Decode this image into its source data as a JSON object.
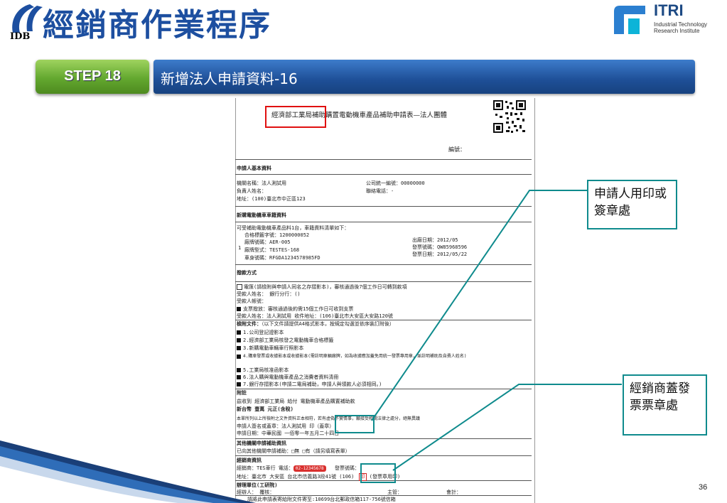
{
  "header": {
    "logo_text": "IDB",
    "title": "經銷商作業程序",
    "partner_logo": {
      "name": "ITRI",
      "subtitle_lines": [
        "Industrial Technology",
        "Research Institute"
      ]
    }
  },
  "step": {
    "badge": "STEP 18",
    "title": "新增法人申請資料-16"
  },
  "document": {
    "form_title": "經濟部工業局補助購置電動機車產品補助申請表—法人團體",
    "serial_label": "編號：",
    "applicant": {
      "heading": "申請人基本資料",
      "org_name": "機關名稱：法人測試用",
      "owner": "負責人姓名：",
      "address": "地址：(100)臺北市中正區123",
      "tax_id": "公司統一編號：00000000",
      "phone": "聯絡電話：-"
    },
    "vehicle": {
      "heading": "新購電動機車車籍資料",
      "intro": "可受補助電動機車產品料1台，車籍資料清單如下：",
      "index": "1",
      "lines": [
        "合格標籤字號：1200000052",
        "廠牌號碼：AER-005",
        "廠牌型式：TESTES-168",
        "車身號碼：RFGDA1234578985FD"
      ],
      "right_lines": [
        "出廠日期：2012/05",
        "發票號碼：QW85968596",
        "發票日期：2012/05/22"
      ]
    },
    "payment": {
      "heading": "撥款方式",
      "option1": "電匯(請檢附與申請人同名之存摺影本)，審核通過後7個工作日可轉到款項",
      "payee": "受款人姓名：  銀行分行：()",
      "account": "受款人帳號：",
      "option2": "支票撥放：審核通過後約需15個工作日可收到支票",
      "mail": "受款人姓名：法人測試用  收件地址：(106)臺北市大安區大安路120號"
    },
    "attachments": {
      "heading": "檢附文件：",
      "note": "（以下文件請提供A4格式影本，按規定勾選並依序裝訂附後）",
      "items": [
        "1.公司登記證影本",
        "2.經濟部工業局核發之電動機車合格標籤",
        "3.新購電動車輛車行照影本",
        "4.購車發票或收據影本或收據影本(需註明車輛廠牌，如為收據應加蓋免用統一發票專用章，並註明補助及自費人姓名)",
        "5.工業局核准函影本",
        "6.法人購與電動機車產品之消費者資料清冊",
        "7.銀行存摺影本(申請二電局補助，申請人與領款人必須相同。)"
      ]
    },
    "consent": {
      "heading": "附註",
      "line1": "茲收到 經濟部工業局  給付  電動機車產品購置補助款",
      "line2": "新台幣 壹萬 元正(含稅)",
      "line3": "本單所列以上所檢附之文件資料正本相符，若有虛偽不實情事，願接受相關法律之處分，絕無異議",
      "line4": "申請人簽名或蓋章：法人測試用     印（蓋章）",
      "line5": "申請日期：中華民國 一佰零一年五月二十四日"
    },
    "other_subsidy": {
      "heading": "其他機關申請補助資訊",
      "line": "已向其他機關申請補助：□無 □有（請另填寫表單）"
    },
    "dealer": {
      "heading": "經銷商資訊",
      "line1_prefix": "經銷商：TES車行 電話：",
      "phone": "02-12345678",
      "line1_suffix": "發票號碼：",
      "line2": "地址：臺北市 大安區 台北市信義路3段41號 (106)",
      "stamp_char": "印",
      "stamp_label": "(發票章用印)"
    },
    "handler": {
      "heading": "辦理單位(工研院)",
      "reviewer": "經辦人：  覆核：",
      "supervisor": "主管：",
      "accountant": "會計："
    },
    "footer_note": "請將此申請表寄給附文件寄至:10699台北郵政信箱117-756號信箱"
  },
  "callouts": {
    "applicant_seal": "申請人用印或簽章處",
    "dealer_seal": "經銷商蓋發票票章處"
  },
  "page_number": "36",
  "colors": {
    "title_blue": "#1d4fa0",
    "step_bar": "#1e4f97",
    "step_badge": "#63a82f",
    "callout_border": "#0f8b8d",
    "highlight_red": "#e01010"
  }
}
